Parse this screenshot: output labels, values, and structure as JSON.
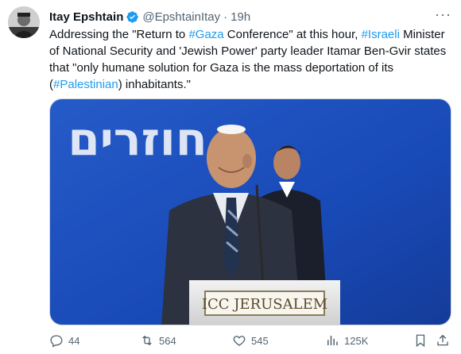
{
  "author": {
    "name": "Itay Epshtain",
    "handle": "@EpshtainItay",
    "separator": "·",
    "time": "19h",
    "verified": true
  },
  "tweet": {
    "segments": [
      {
        "text": "Addressing the \"Return to ",
        "tag": false
      },
      {
        "text": "#Gaza",
        "tag": true
      },
      {
        "text": " Conference\" at this hour, ",
        "tag": false
      },
      {
        "text": "#Israeli",
        "tag": true
      },
      {
        "text": " Minister of National Security and 'Jewish Power' party leader Itamar Ben-Gvir states that \"only humane solution for Gaza is the mass deportation of its (",
        "tag": false
      },
      {
        "text": "#Palestinian",
        "tag": true
      },
      {
        "text": ") inhabitants.\"",
        "tag": false
      }
    ]
  },
  "media": {
    "banner_text": "חוזרים",
    "podium_text": "ICC JERUSALEM"
  },
  "actions": {
    "reply_count": "44",
    "retweet_count": "564",
    "like_count": "545",
    "views_count": "125K"
  },
  "colors": {
    "link": "#1d9bf0",
    "secondary": "#536471",
    "stage_blue": "#1e56c8"
  },
  "icons": {
    "more": "more-icon",
    "verified": "verified-badge-icon",
    "reply": "reply-icon",
    "retweet": "retweet-icon",
    "like": "like-icon",
    "views": "views-icon",
    "bookmark": "bookmark-icon",
    "share": "share-icon"
  }
}
